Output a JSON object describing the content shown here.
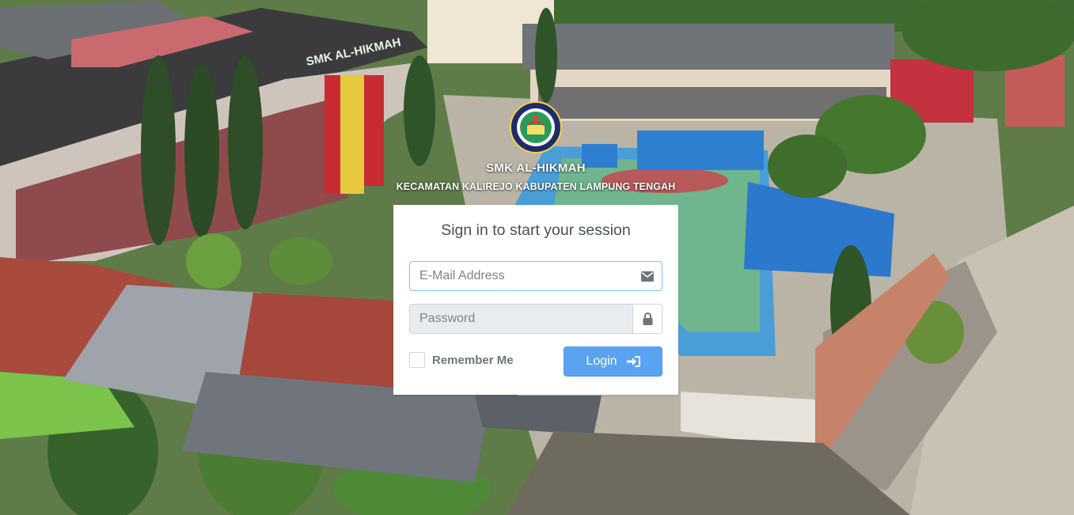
{
  "brand": {
    "name": "SMK AL-HIKMAH",
    "subtitle": "KECAMATAN KALIREJO KABUPATEN LAMPUNG TENGAH",
    "building_sign": "SMK AL-HIKMAH"
  },
  "login": {
    "message": "Sign in to start your session",
    "email_placeholder": "E-Mail Address",
    "email_icon": "envelope-icon",
    "password_placeholder": "Password",
    "password_icon": "lock-icon",
    "remember_label": "Remember Me",
    "remember_checked": false,
    "button_label": "Login",
    "button_icon": "sign-in-icon"
  },
  "colors": {
    "primary": "#5aa3f0",
    "focus_border": "#80bdff",
    "text": "#495057",
    "muted": "#6c757d"
  }
}
